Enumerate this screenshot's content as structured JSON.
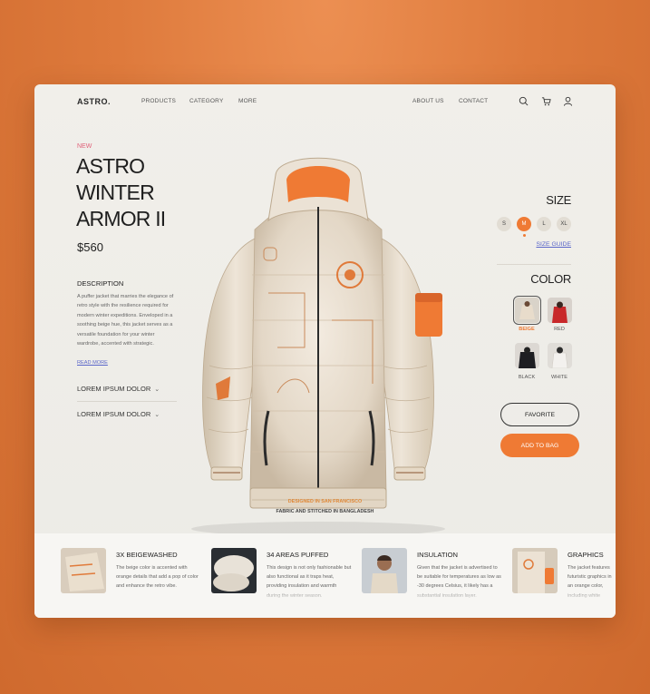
{
  "nav": {
    "logo": "ASTRO.",
    "links_left": [
      "PRODUCTS",
      "CATEGORY",
      "MORE"
    ],
    "links_right": [
      "ABOUT US",
      "CONTACT"
    ],
    "icons": [
      "search-icon",
      "cart-icon",
      "user-icon"
    ]
  },
  "product": {
    "badge": "NEW",
    "title_lines": [
      "ASTRO",
      "WINTER",
      "ARMOR II"
    ],
    "price": "$560",
    "description_heading": "DESCRIPTION",
    "description": "A puffer jacket that marries the elegance of retro style with the resilience required for modern winter expeditions. Enveloped in a soothing beige hue, this jacket serves as a versatile foundation for your winter wardrobe, accented with strategic.",
    "read_more": "READ MORE",
    "accordions": [
      "LOREM IPSUM DOLOR",
      "LOREM IPSUM DOLOR"
    ],
    "made_in": "DESIGNED IN SAN FRANCISCO",
    "fabric": "FABRIC AND STITCHED IN BANGLADESH"
  },
  "size": {
    "heading": "SIZE",
    "options": [
      "S",
      "M",
      "L",
      "XL"
    ],
    "selected": "M",
    "guide": "SIZE GUIDE"
  },
  "color": {
    "heading": "COLOR",
    "options": [
      {
        "label": "BEIGE",
        "swatch": "#e8dccb",
        "selected": true
      },
      {
        "label": "RED",
        "swatch": "#c8282a",
        "selected": false
      },
      {
        "label": "BLACK",
        "swatch": "#1e1e22",
        "selected": false
      },
      {
        "label": "WHITE",
        "swatch": "#eceae6",
        "selected": false
      }
    ]
  },
  "actions": {
    "favorite": "FAVORITE",
    "add_to_bag": "ADD TO BAG"
  },
  "features": [
    {
      "title": "3X BEIGEWASHED",
      "text": "The beige color is accented with orange details that add a pop of color and enhance the retro vibe."
    },
    {
      "title": "34 AREAS PUFFED",
      "text": "This design is not only fashionable but also functional as it traps heat, providing insulation and warmth during the winter season."
    },
    {
      "title": "INSULATION",
      "text": "Given that the jacket is advertised to be suitable for temperatures as low as -30 degrees Celsius, it likely has a substantial insulation layer."
    },
    {
      "title": "GRAPHICS",
      "text": "The jacket features futuristic graphics in an orange color, including white"
    }
  ],
  "colors": {
    "accent": "#ef7a34",
    "link": "#5a66c9",
    "badge": "#e0607a",
    "background": "#de7a3c",
    "card": "#efede8"
  }
}
